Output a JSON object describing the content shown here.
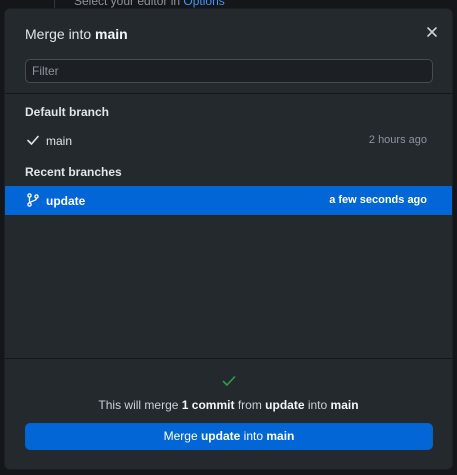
{
  "background": {
    "editor_hint_prefix": "Select your editor in",
    "editor_hint_link": "Options"
  },
  "dialog": {
    "title_prefix": "Merge into",
    "title_branch": "main",
    "close_icon": "close-icon"
  },
  "filter": {
    "placeholder": "Filter",
    "value": ""
  },
  "default_section": {
    "label": "Default branch",
    "branches": [
      {
        "name": "main",
        "time": "2 hours ago",
        "icon": "check-icon",
        "selected": false
      }
    ]
  },
  "recent_section": {
    "label": "Recent branches",
    "branches": [
      {
        "name": "update",
        "time": "a few seconds ago",
        "icon": "git-branch-icon",
        "selected": true
      }
    ]
  },
  "footer": {
    "status_icon": "check-icon",
    "summary": {
      "prefix": "This will merge",
      "count": "1 commit",
      "from_word": "from",
      "source": "update",
      "into_word": "into",
      "target": "main"
    },
    "button": {
      "prefix": "Merge",
      "source": "update",
      "into_word": "into",
      "target": "main"
    }
  },
  "colors": {
    "accent": "#0366d6",
    "success": "#2ea043",
    "dialog_bg": "#24292e"
  }
}
